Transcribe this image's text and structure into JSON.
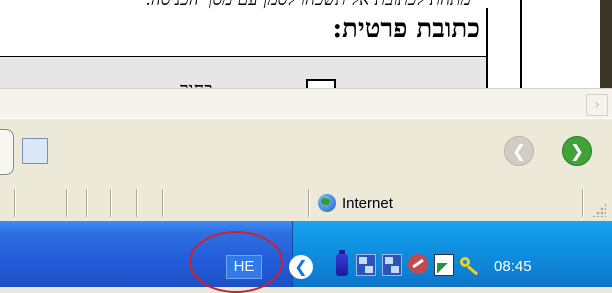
{
  "page": {
    "cutoff_text": "מתחת לכתובת אל תשכחו לסמן עם מסך הכניסה.",
    "form_title": "כתובת פרטית:",
    "checkbox_label": "בחור"
  },
  "toolbar": {
    "back_icon": "back-arrow-icon",
    "forward_icon": "forward-arrow-icon"
  },
  "statusbar": {
    "zone_label": "Internet",
    "zone_icon": "globe-icon"
  },
  "taskbar": {
    "language": "HE",
    "clock": "08:45",
    "tray_icons": [
      "show-hidden-icons-chevron",
      "battery-icon",
      "network-icon",
      "network-icon",
      "security-icon",
      "chart-icon",
      "key-icon"
    ],
    "highlight_color": "#d0202a"
  }
}
